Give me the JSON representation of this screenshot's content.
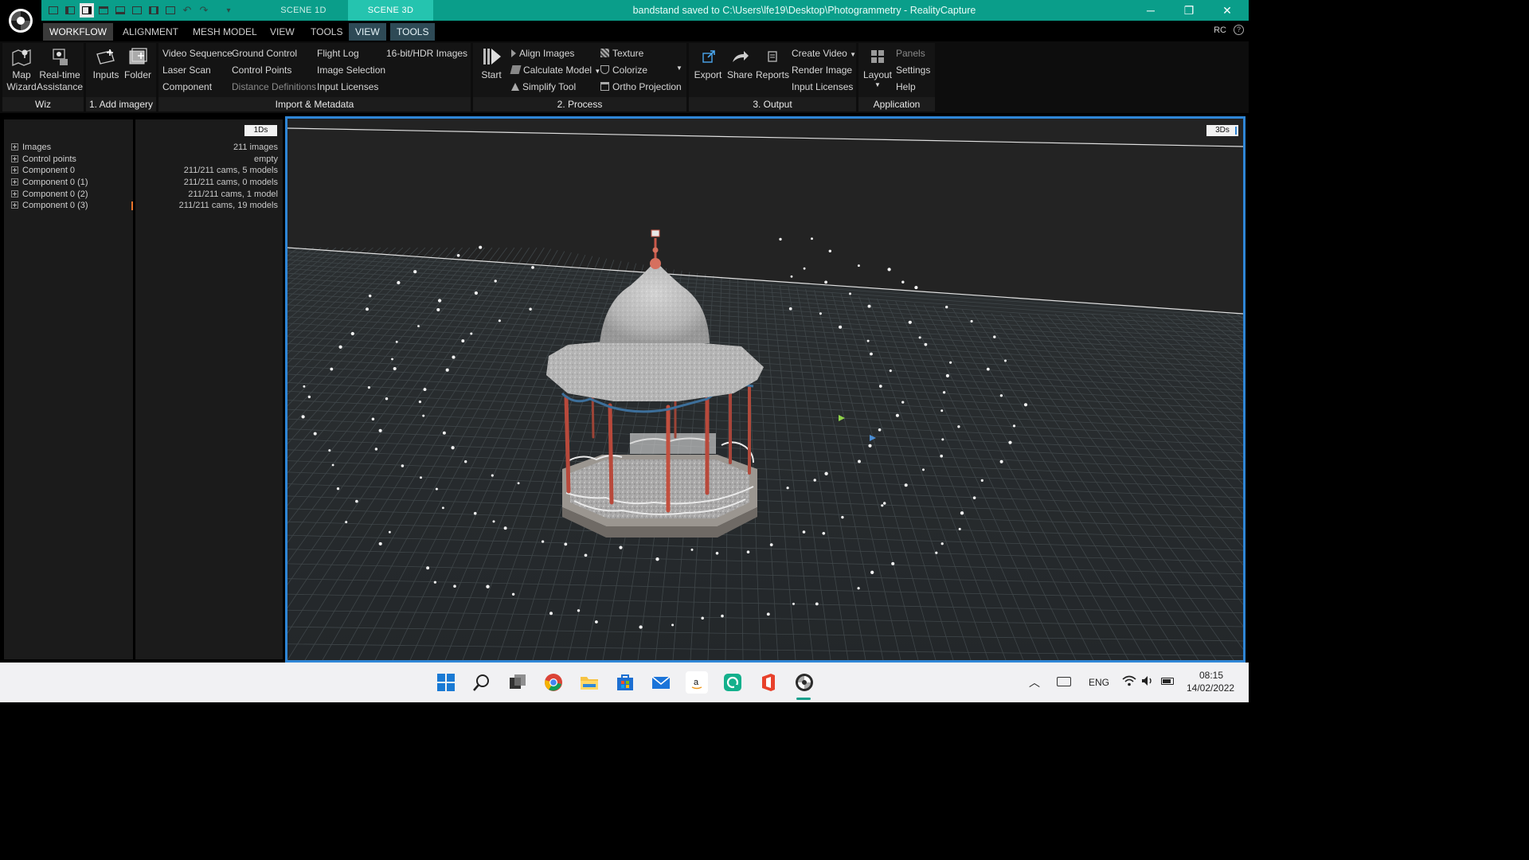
{
  "app": {
    "title": "bandstand saved to C:\\Users\\lfe19\\Desktop\\Photogrammetry - RealityCapture",
    "scene_tabs": [
      "SCENE 1D",
      "SCENE 3D"
    ],
    "active_scene_tab": "SCENE 3D",
    "rc_label": "RC",
    "help": "?",
    "accent": "#0a9e8a",
    "viewport_border": "#2f86d6"
  },
  "window_controls": {
    "minimize": "─",
    "restore": "❐",
    "close": "✕"
  },
  "menu": {
    "items": [
      "WORKFLOW",
      "ALIGNMENT",
      "MESH MODEL",
      "VIEW",
      "TOOLS",
      "VIEW",
      "TOOLS"
    ],
    "active": "WORKFLOW"
  },
  "ribbon": {
    "wiz": {
      "label": "Wiz",
      "map_wizard": "Map\nWizard",
      "realtime": "Real-time\nAssistance"
    },
    "add_imagery": {
      "label": "1. Add imagery",
      "inputs": "Inputs",
      "folder": "Folder"
    },
    "import_metadata": {
      "label": "Import & Metadata",
      "col1": [
        "Video Sequence",
        "Laser Scan",
        "Component"
      ],
      "col2": [
        "Ground Control",
        "Control Points",
        "Distance Definitions"
      ],
      "col3": [
        "Flight Log",
        "Image Selection",
        "Input Licenses"
      ],
      "col4": [
        "16-bit/HDR Images"
      ]
    },
    "process": {
      "label": "2. Process",
      "start": "Start",
      "col1": [
        "Align Images",
        "Calculate Model",
        "Simplify Tool"
      ],
      "col2": [
        "Texture",
        "Colorize",
        "Ortho Projection"
      ]
    },
    "output": {
      "label": "3. Output",
      "export": "Export",
      "share": "Share",
      "reports": "Reports",
      "col": [
        "Create Video",
        "Render Image",
        "Input Licenses"
      ]
    },
    "application": {
      "label": "Application",
      "layout": "Layout",
      "col": [
        "Panels",
        "Settings",
        "Help"
      ]
    }
  },
  "panel_1ds": {
    "tab": "1Ds",
    "rows": [
      {
        "name": "Images",
        "value": "211 images"
      },
      {
        "name": "Control points",
        "value": "empty"
      },
      {
        "name": "Component 0",
        "value": "211/211 cams, 5 models"
      },
      {
        "name": "Component 0 (1)",
        "value": "211/211 cams, 0 models"
      },
      {
        "name": "Component 0 (2)",
        "value": "211/211 cams, 1 model"
      },
      {
        "name": "Component 0 (3)",
        "value": "211/211 cams, 19 models"
      }
    ]
  },
  "viewport": {
    "tab": "3Ds"
  },
  "taskbar": {
    "icons": [
      "windows-start-icon",
      "search-icon",
      "task-view-icon",
      "chrome-icon",
      "file-explorer-icon",
      "microsoft-store-icon",
      "mail-icon",
      "amazon-icon",
      "teams-icon",
      "office-icon",
      "realitycapture-icon"
    ],
    "language": "ENG",
    "time": "08:15",
    "date": "14/02/2022"
  }
}
